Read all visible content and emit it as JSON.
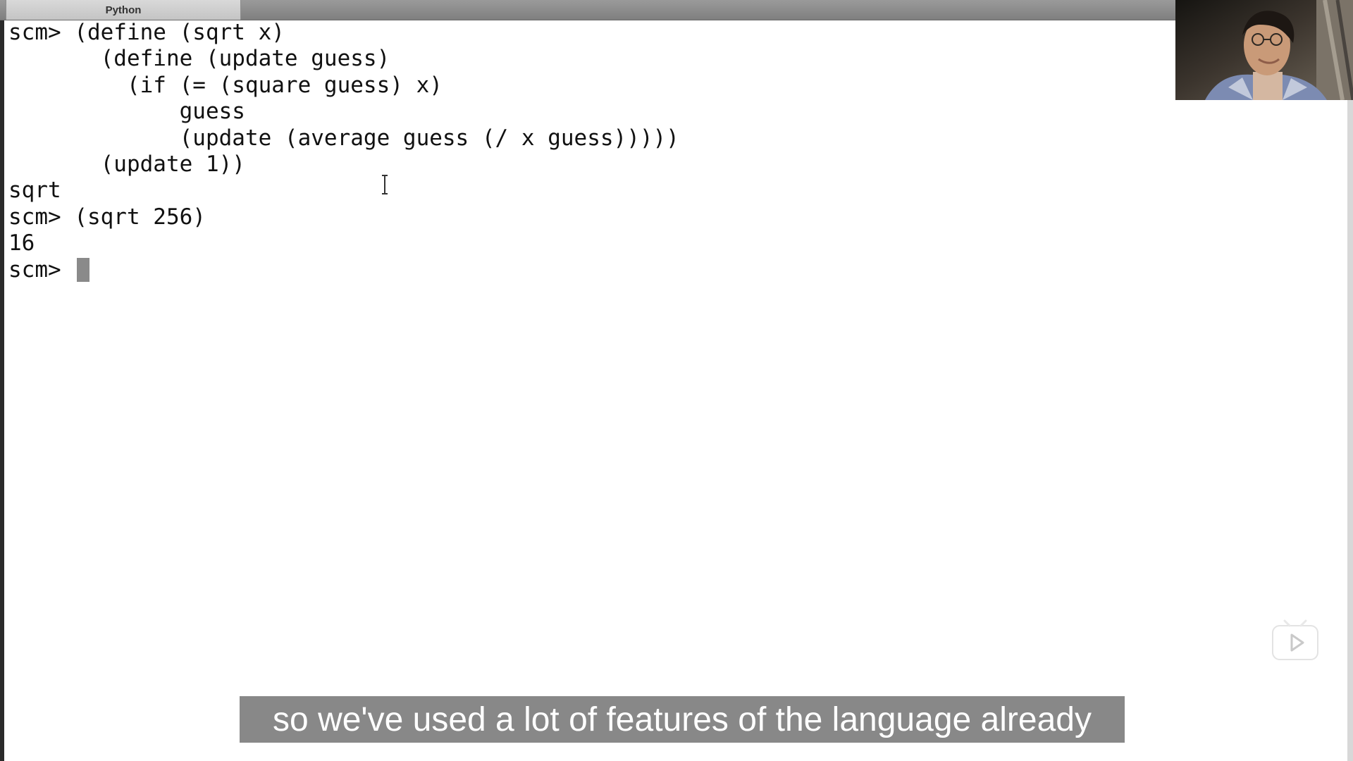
{
  "window": {
    "tab_title": "Python"
  },
  "terminal": {
    "lines": [
      "scm> (define (sqrt x)",
      "       (define (update guess)",
      "         (if (= (square guess) x)",
      "             guess",
      "             (update (average guess (/ x guess)))))",
      "       (update 1))",
      "sqrt",
      "scm> (sqrt 256)",
      "16"
    ],
    "prompt": "scm> "
  },
  "subtitle": {
    "text": "so we've used a lot of features of the language already"
  },
  "icons": {
    "webcam": "presenter-webcam-icon",
    "text_cursor": "ibeam-cursor-icon",
    "play": "play-button-icon"
  }
}
